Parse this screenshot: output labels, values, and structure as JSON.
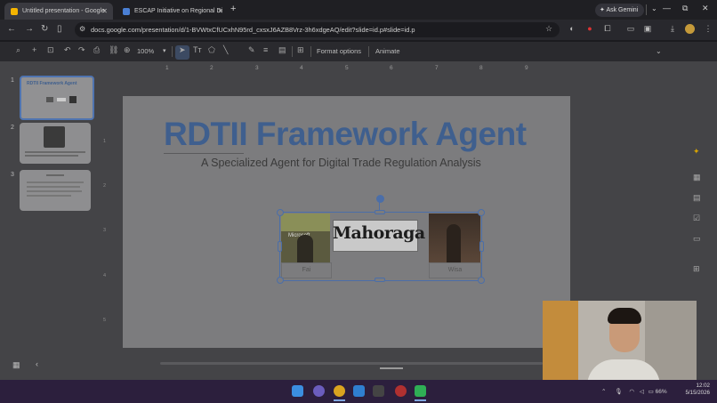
{
  "browser": {
    "tabs": [
      {
        "title": "Untitled presentation - Google",
        "favicon_color": "#f4b400",
        "active": true
      },
      {
        "title": "ESCAP Initiative on Regional Di",
        "favicon_color": "#4a7fd4",
        "active": false
      }
    ],
    "new_tab": "+",
    "ask_gemini": "Ask Gemini",
    "url": "docs.google.com/presentation/d/1-BVWtxCfUCxhN95rd_cxsxJ6AZB8Vrz-3h6xdgeAQ/edit?slide=id.p#slide=id.p",
    "window_controls": [
      "—",
      "⧉",
      "✕"
    ]
  },
  "slides_toolbar": {
    "zoom": "100%",
    "format_options": "Format options",
    "animate": "Animate"
  },
  "filmstrip": {
    "numbers": [
      "1",
      "2",
      "3"
    ],
    "thumb1_title": "RDTII Framework Agent"
  },
  "ruler": {
    "h": [
      "1",
      "2",
      "3",
      "4",
      "5",
      "6",
      "7",
      "8",
      "9"
    ]
  },
  "slide": {
    "title": "RDTII Framework Agent",
    "subtitle": "A Specialized Agent for Digital Trade Regulation Analysis",
    "center_logo": "Mahoraga",
    "fai_logo": "Microsoft",
    "caption_left": "Fai",
    "caption_right": "Wisa"
  },
  "colors": {
    "title": "#3f5f8e",
    "selection": "#4b6ea8",
    "taskbar": "#2c1f3d",
    "accent_sidebar_icon": "#d8a400"
  },
  "taskbar": {
    "time": "12:02",
    "date": "5/15/2026",
    "battery": "66%"
  }
}
